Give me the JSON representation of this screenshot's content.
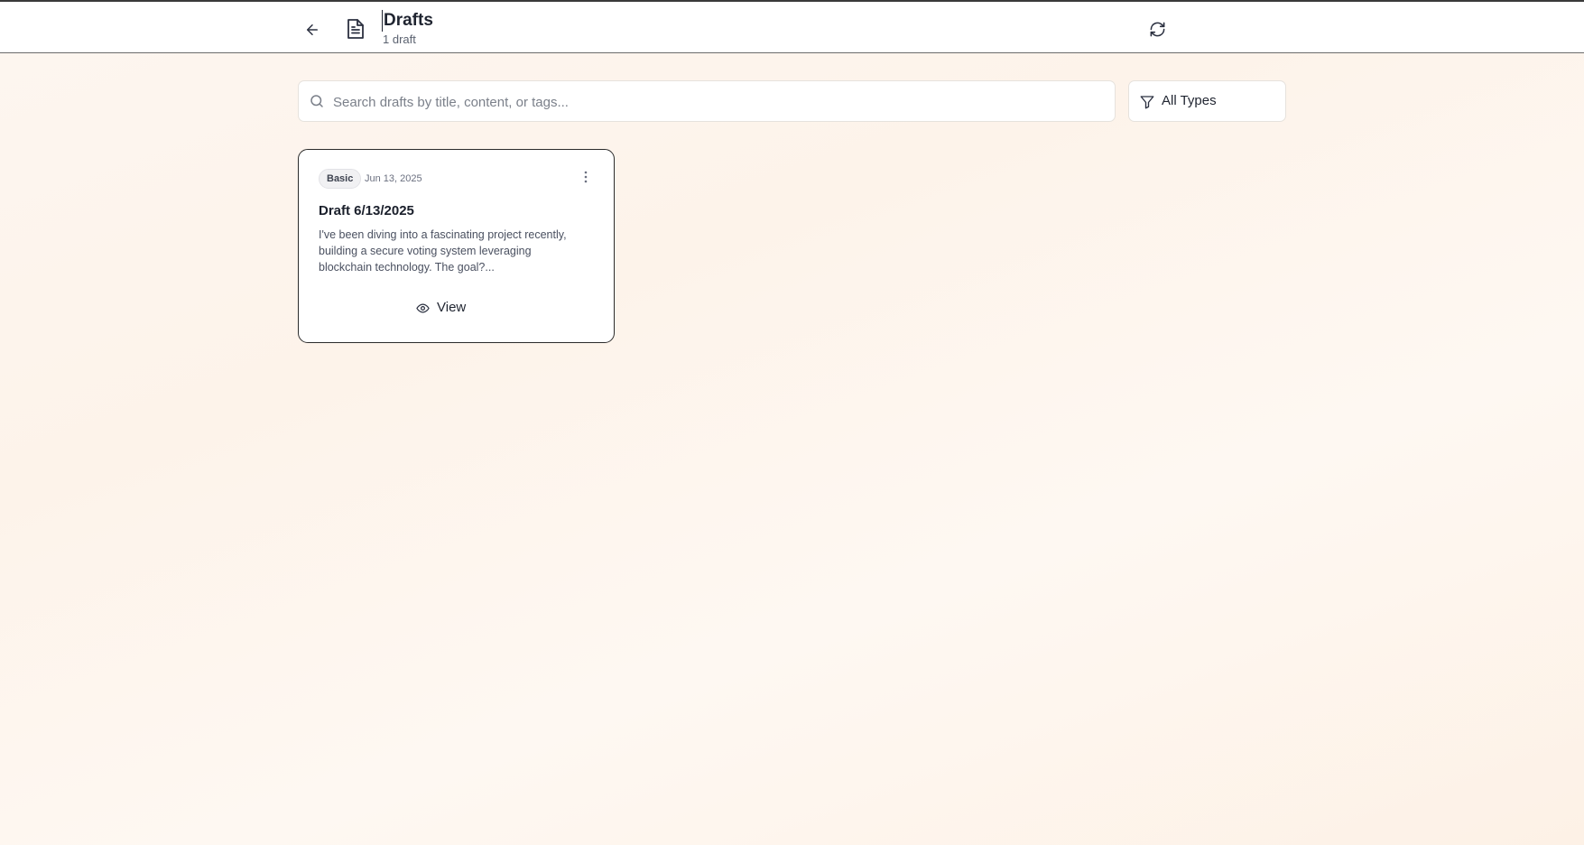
{
  "header": {
    "back_icon": "arrow-left-icon",
    "page_icon": "document-icon",
    "title": "Drafts",
    "subtitle": "1 draft",
    "refresh_icon": "refresh-icon"
  },
  "search": {
    "icon": "search-icon",
    "placeholder": "Search drafts by title, content, or tags...",
    "value": ""
  },
  "filter": {
    "icon": "filter-icon",
    "selected": "All Types"
  },
  "drafts": [
    {
      "badge": "Basic",
      "date": "Jun 13, 2025",
      "menu_icon": "more-vertical-icon",
      "title": "Draft 6/13/2025",
      "excerpt": "I've been diving into a fascinating project recently, building a secure voting system leveraging blockchain technology. The goal?...",
      "view_label": "View",
      "view_icon": "eye-icon"
    }
  ],
  "colors": {
    "text_primary": "#1f2430",
    "text_muted": "#6b7080",
    "card_border": "#2b2b2b",
    "background": "#fdf6f0"
  }
}
